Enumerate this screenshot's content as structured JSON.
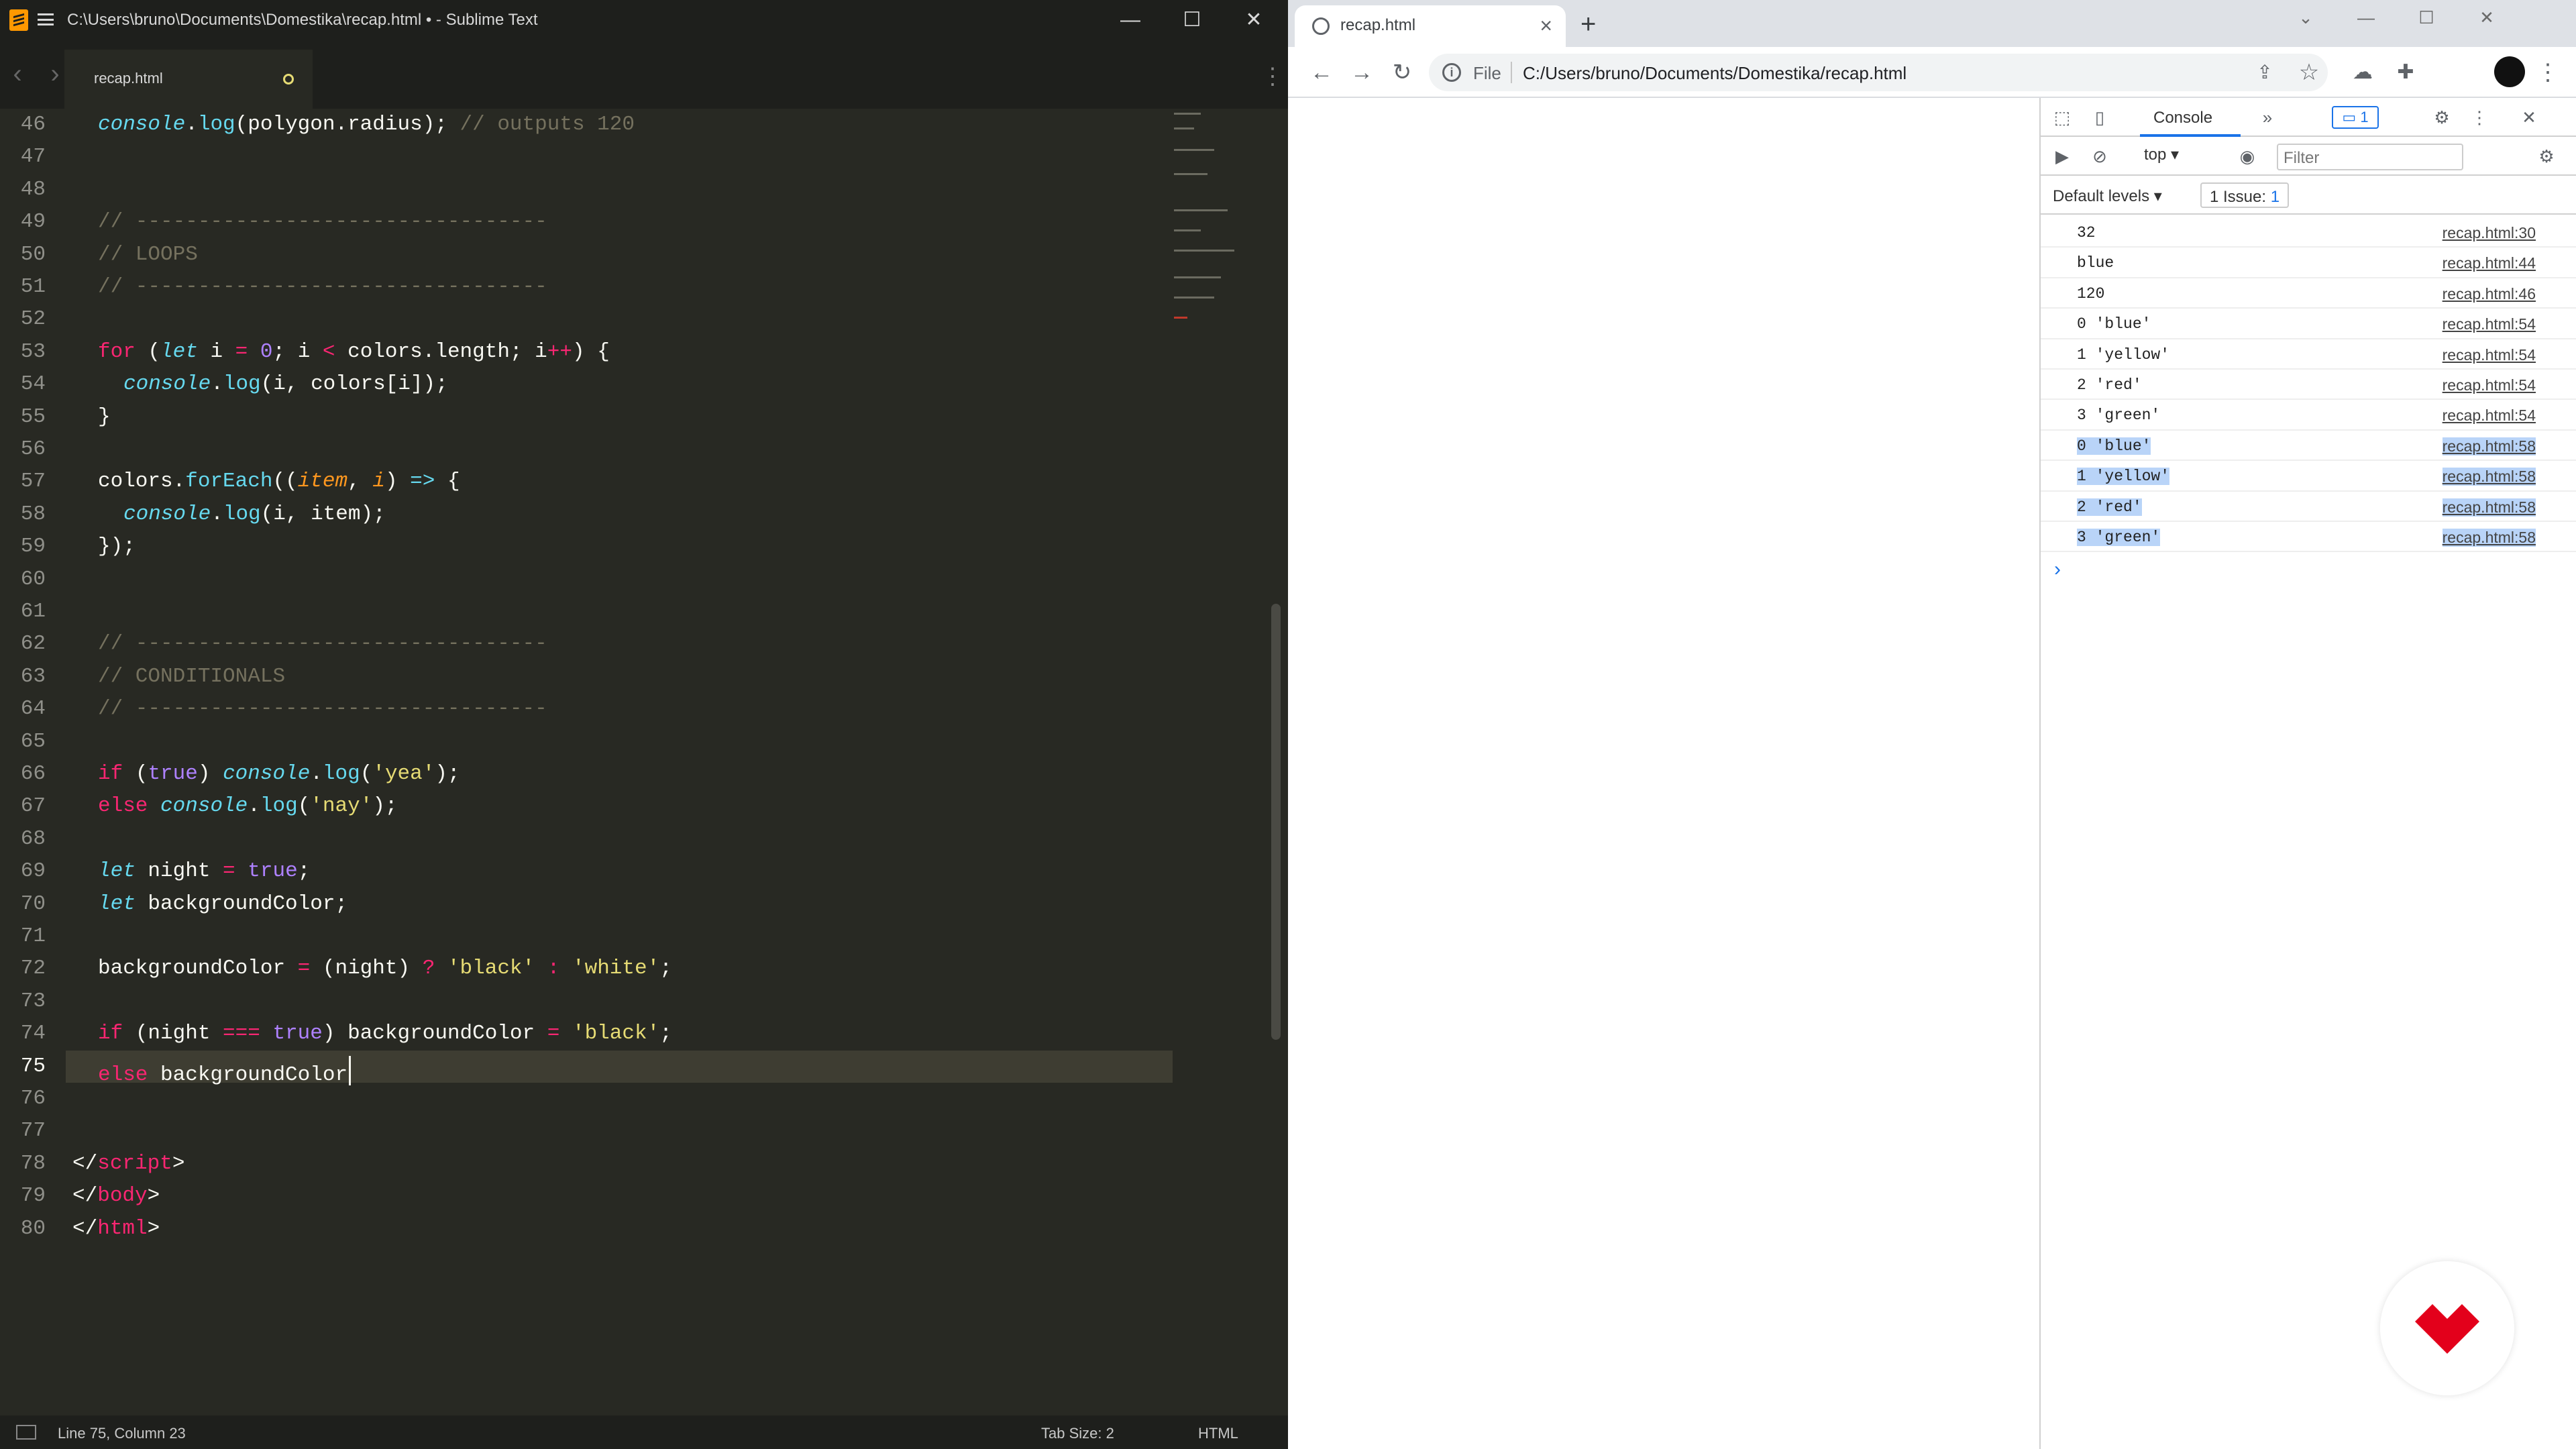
{
  "sublime": {
    "title": "C:\\Users\\bruno\\Documents\\Domestika\\recap.html • - Sublime Text",
    "tab_label": "recap.html",
    "status_position": "Line 75, Column 23",
    "status_tab_size": "Tab Size: 2",
    "status_syntax": "HTML",
    "line_numbers": [
      "46",
      "47",
      "48",
      "49",
      "50",
      "51",
      "52",
      "53",
      "54",
      "55",
      "56",
      "57",
      "58",
      "59",
      "60",
      "61",
      "62",
      "63",
      "64",
      "65",
      "66",
      "67",
      "68",
      "69",
      "70",
      "71",
      "72",
      "73",
      "74",
      "75",
      "76",
      "77",
      "78",
      "79",
      "80"
    ],
    "current_line": "75"
  },
  "chrome": {
    "tab_title": "recap.html",
    "url_scheme": "File",
    "url": "C:/Users/bruno/Documents/Domestika/recap.html"
  },
  "devtools": {
    "console_tab": "Console",
    "issue_count": "1",
    "context": "top",
    "filter_placeholder": "Filter",
    "levels": "Default levels",
    "issues_label": "1 Issue:",
    "issues_count": "1",
    "logs": [
      {
        "msg": "32",
        "src": "recap.html:30"
      },
      {
        "msg": "blue",
        "src": "recap.html:44"
      },
      {
        "msg": "120",
        "src": "recap.html:46"
      },
      {
        "msg": "0 'blue'",
        "src": "recap.html:54"
      },
      {
        "msg": "1 'yellow'",
        "src": "recap.html:54"
      },
      {
        "msg": "2 'red'",
        "src": "recap.html:54"
      },
      {
        "msg": "3 'green'",
        "src": "recap.html:54"
      },
      {
        "msg": "0 'blue'",
        "src": "recap.html:58"
      },
      {
        "msg": "1 'yellow'",
        "src": "recap.html:58"
      },
      {
        "msg": "2 'red'",
        "src": "recap.html:58"
      },
      {
        "msg": "3 'green'",
        "src": "recap.html:58"
      }
    ]
  },
  "code_lines": {
    "l46a": "console",
    "l46b": ".",
    "l46c": "log",
    "l46d": "(polygon.radius); ",
    "l46e": "// outputs 120",
    "l49": "// ---------------------------------",
    "l50": "// LOOPS",
    "l51": "// ---------------------------------",
    "l53a": "for",
    "l53b": " (",
    "l53c": "let",
    "l53d": " i ",
    "l53e": "=",
    "l53f": " ",
    "l53g": "0",
    "l53h": "; i ",
    "l53i": "<",
    "l53j": " colors.length; i",
    "l53k": "++",
    "l53l": ") {",
    "l54a": "console",
    "l54b": ".",
    "l54c": "log",
    "l54d": "(i, colors[i]);",
    "l55": "}",
    "l57a": "colors.",
    "l57b": "forEach",
    "l57c": "((",
    "l57d": "item",
    "l57e": ", ",
    "l57f": "i",
    "l57g": ") ",
    "l57h": "=>",
    "l57i": " {",
    "l58a": "console",
    "l58b": ".",
    "l58c": "log",
    "l58d": "(i, item);",
    "l59": "});",
    "l62": "// ---------------------------------",
    "l63": "// CONDITIONALS",
    "l64": "// ---------------------------------",
    "l66a": "if",
    "l66b": " (",
    "l66c": "true",
    "l66d": ") ",
    "l66e": "console",
    "l66f": ".",
    "l66g": "log",
    "l66h": "(",
    "l66i": "'yea'",
    "l66j": ");",
    "l67a": "else",
    "l67b": " ",
    "l67c": "console",
    "l67d": ".",
    "l67e": "log",
    "l67f": "(",
    "l67g": "'nay'",
    "l67h": ");",
    "l69a": "let",
    "l69b": " night ",
    "l69c": "=",
    "l69d": " ",
    "l69e": "true",
    "l69f": ";",
    "l70a": "let",
    "l70b": " backgroundColor;",
    "l72a": "backgroundColor ",
    "l72b": "=",
    "l72c": " (night) ",
    "l72d": "?",
    "l72e": " ",
    "l72f": "'black'",
    "l72g": " ",
    "l72h": ":",
    "l72i": " ",
    "l72j": "'white'",
    "l72k": ";",
    "l74a": "if",
    "l74b": " (night ",
    "l74c": "===",
    "l74d": " ",
    "l74e": "true",
    "l74f": ") backgroundColor ",
    "l74g": "=",
    "l74h": " ",
    "l74i": "'black'",
    "l74j": ";",
    "l75a": "else",
    "l75b": " backgroundColor",
    "l78a": "</",
    "l78b": "script",
    "l78c": ">",
    "l79a": "</",
    "l79b": "body",
    "l79c": ">",
    "l80a": "</",
    "l80b": "html",
    "l80c": ">"
  },
  "colors": {
    "editor_bg": "#282923",
    "keyword": "#f92672",
    "string": "#e6db74",
    "number": "#ae81ff",
    "comment": "#75715e",
    "chrome_accent": "#1a73e8",
    "domestika_red": "#e3001b"
  }
}
